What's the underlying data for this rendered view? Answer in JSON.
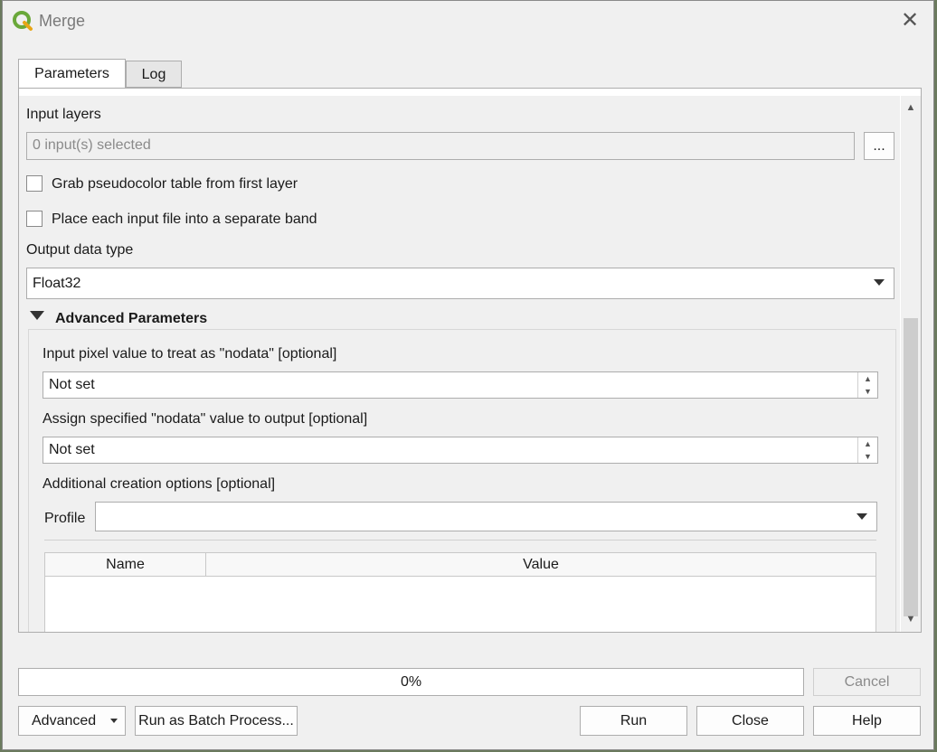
{
  "window": {
    "title": "Merge",
    "close_icon": "close-icon"
  },
  "tabs": [
    {
      "label": "Parameters",
      "active": true
    },
    {
      "label": "Log",
      "active": false
    }
  ],
  "params": {
    "input_layers_label": "Input layers",
    "input_layers_value": "0 input(s) selected",
    "browse_label": "...",
    "grab_pseudocolor_label": "Grab pseudocolor table from first layer",
    "separate_band_label": "Place each input file into a separate band",
    "output_type_label": "Output data type",
    "output_type_value": "Float32",
    "advanced_header": "Advanced Parameters",
    "nodata_input_label": "Input pixel value to treat as \"nodata\" [optional]",
    "nodata_input_value": "Not set",
    "nodata_output_label": "Assign specified \"nodata\" value to output [optional]",
    "nodata_output_value": "Not set",
    "creation_options_label": "Additional creation options [optional]",
    "profile_label": "Profile",
    "profile_value": "",
    "table_columns": [
      "Name",
      "Value"
    ]
  },
  "progress": {
    "text": "0%",
    "value": 0
  },
  "buttons": {
    "cancel": "Cancel",
    "advanced": "Advanced",
    "batch": "Run as Batch Process...",
    "run": "Run",
    "close": "Close",
    "help": "Help"
  }
}
